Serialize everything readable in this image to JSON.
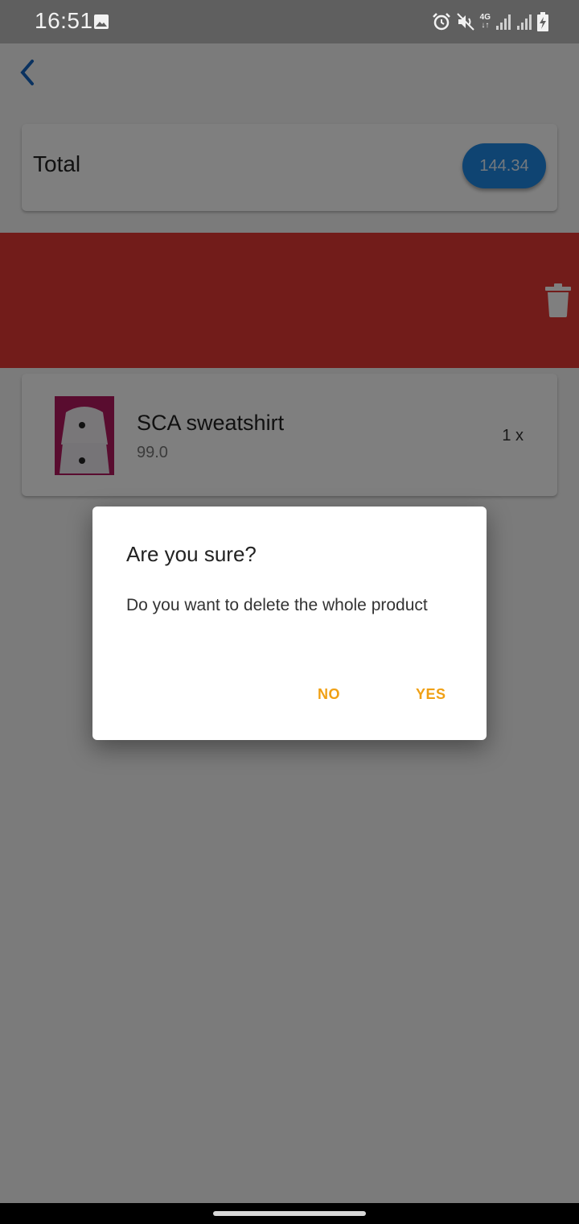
{
  "status_bar": {
    "time": "16:51",
    "icons": [
      "gallery-icon",
      "alarm-icon",
      "mute-icon",
      "4g-icon",
      "signal-icon",
      "signal-icon-2",
      "battery-charging-icon"
    ],
    "network_label": "4G"
  },
  "header": {
    "back_icon": "chevron-left-icon"
  },
  "total": {
    "label": "Total",
    "amount": "144.34"
  },
  "dismiss": {
    "icon": "trash-icon",
    "background": "#e53935"
  },
  "cart_item": {
    "name": "SCA sweatshirt",
    "price": "99.0",
    "quantity": "1 x"
  },
  "dialog": {
    "title": "Are you sure?",
    "message": "Do you want to delete the whole product",
    "no_label": "NO",
    "yes_label": "YES",
    "button_color": "#f0a014"
  },
  "colors": {
    "accent": "#1e88e5",
    "danger": "#e53935"
  }
}
